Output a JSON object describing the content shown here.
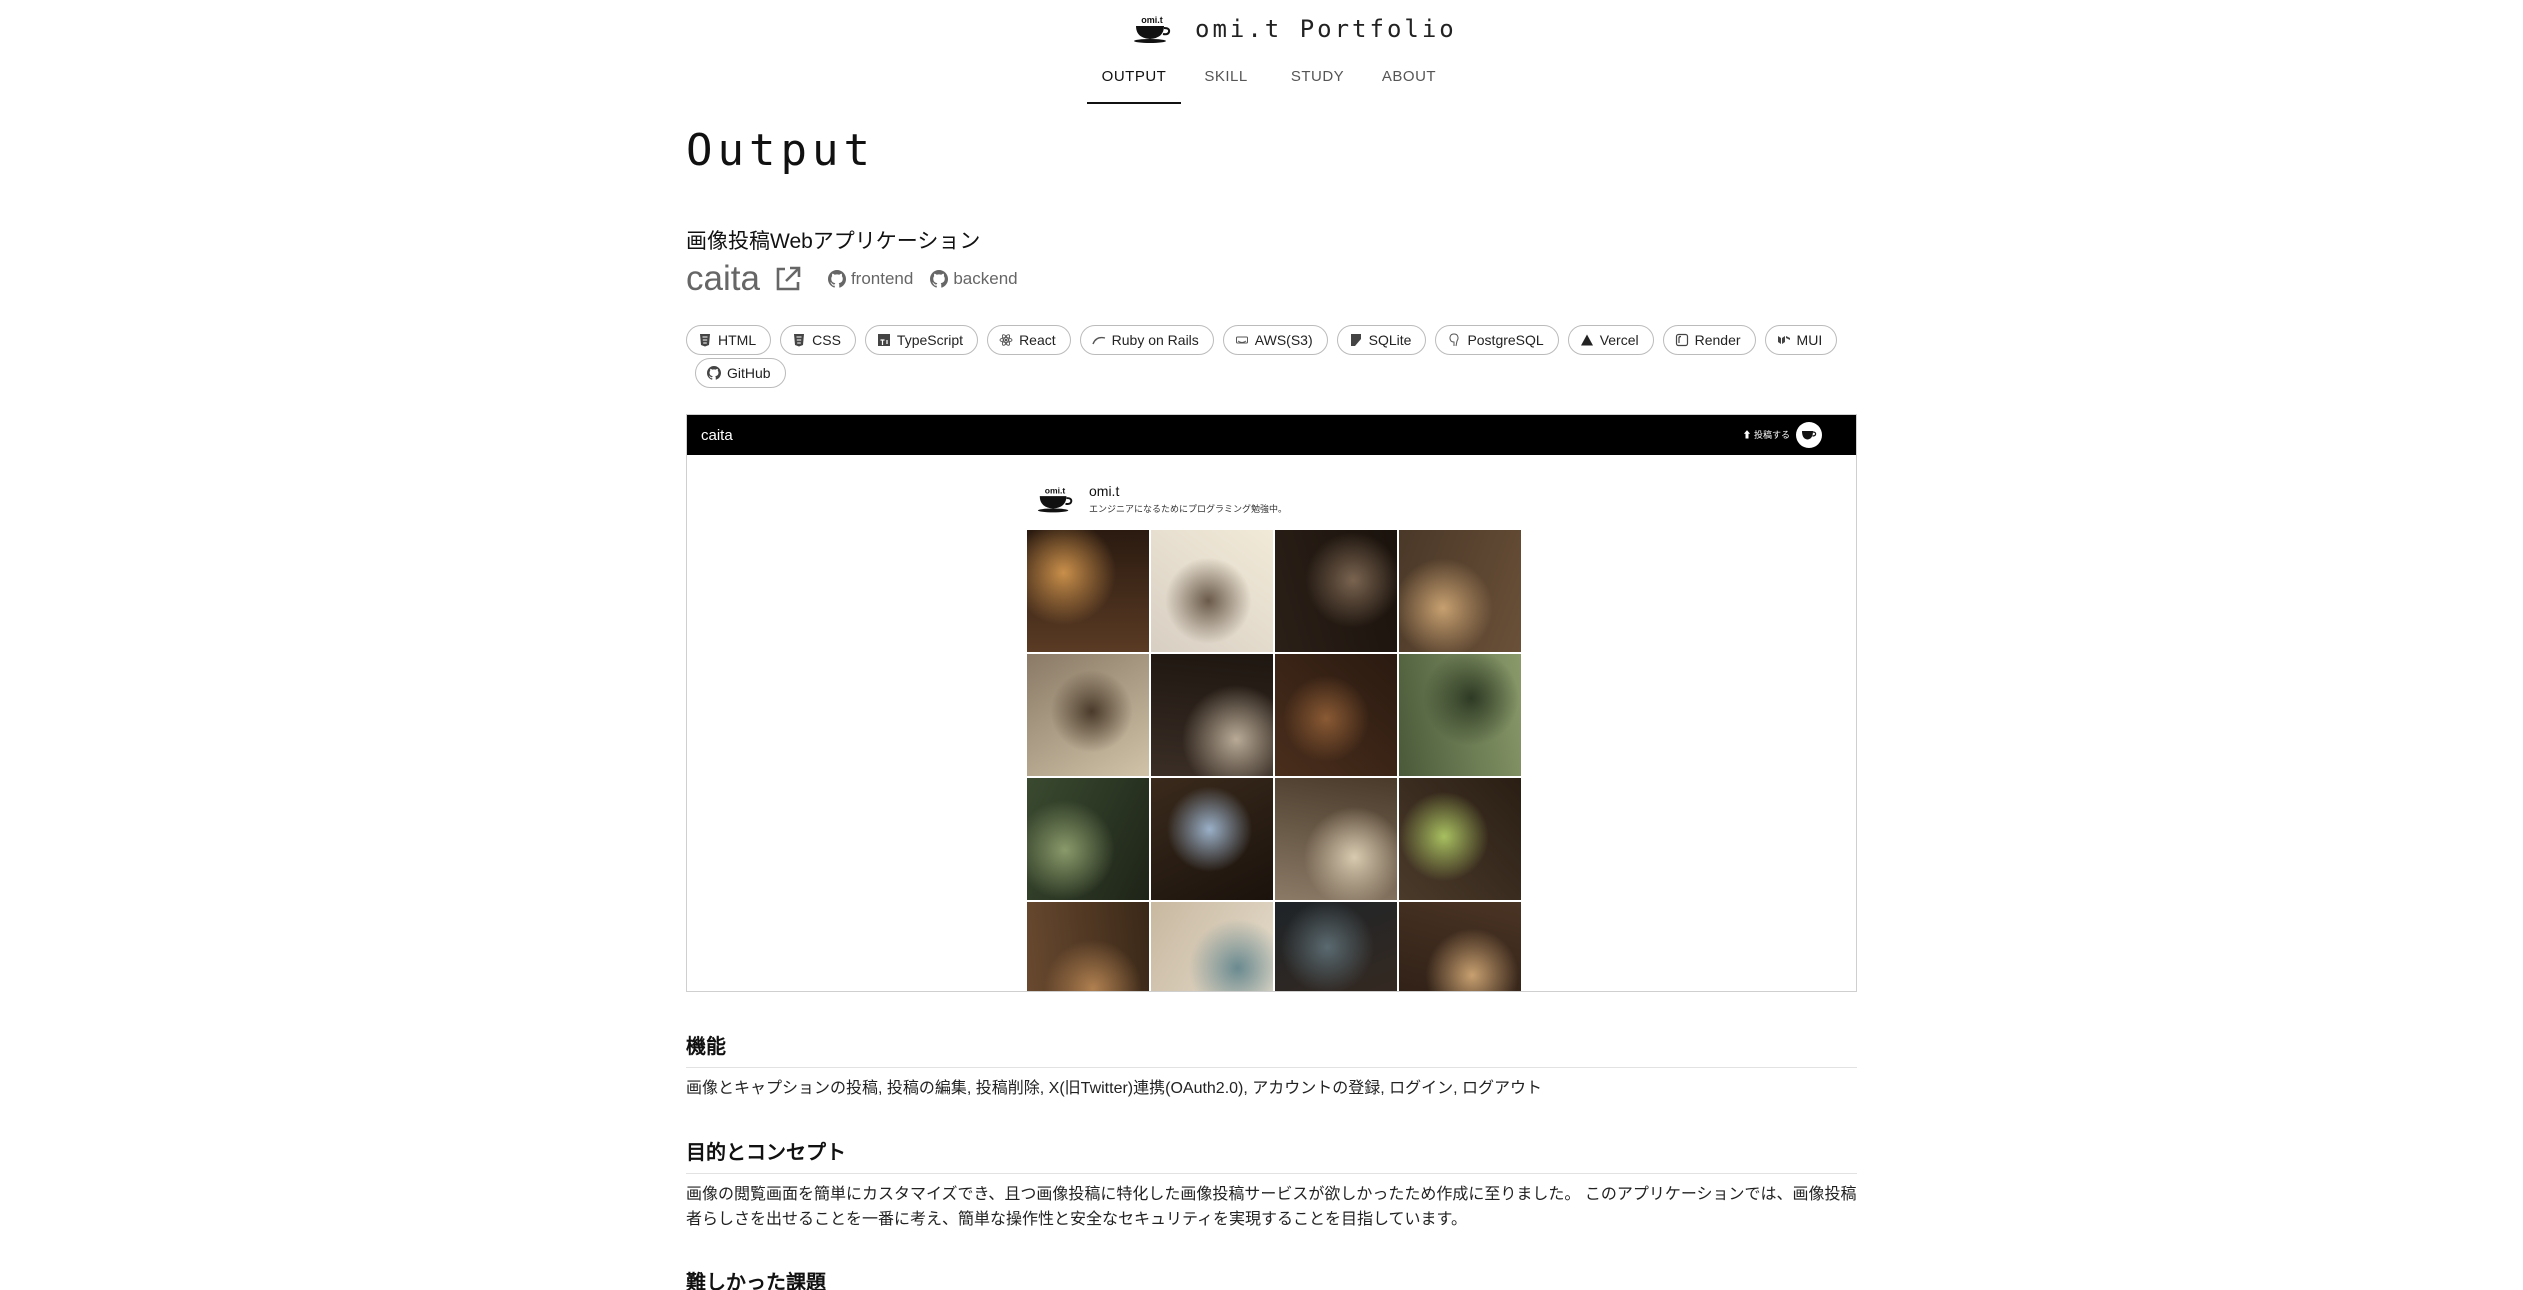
{
  "site": {
    "title": "omi.t Portfolio",
    "logo_text": "omi.t"
  },
  "nav": {
    "tabs": [
      {
        "label": "OUTPUT",
        "active": true
      },
      {
        "label": "SKILL",
        "active": false
      },
      {
        "label": "STUDY",
        "active": false
      },
      {
        "label": "ABOUT",
        "active": false
      }
    ]
  },
  "page": {
    "title": "Output"
  },
  "app": {
    "subtitle": "画像投稿Webアプリケーション",
    "name": "caita",
    "external_link_icon": "external-link-icon",
    "repos": [
      {
        "label": "frontend",
        "icon": "github-icon"
      },
      {
        "label": "backend",
        "icon": "github-icon"
      }
    ],
    "tags": [
      {
        "label": "HTML",
        "icon": "html5-icon"
      },
      {
        "label": "CSS",
        "icon": "css3-icon"
      },
      {
        "label": "TypeScript",
        "icon": "typescript-icon"
      },
      {
        "label": "React",
        "icon": "react-icon"
      },
      {
        "label": "Ruby on Rails",
        "icon": "rails-icon"
      },
      {
        "label": "AWS(S3)",
        "icon": "aws-icon"
      },
      {
        "label": "SQLite",
        "icon": "sqlite-icon"
      },
      {
        "label": "PostgreSQL",
        "icon": "postgresql-icon"
      },
      {
        "label": "Vercel",
        "icon": "vercel-icon"
      },
      {
        "label": "Render",
        "icon": "render-icon"
      },
      {
        "label": "MUI",
        "icon": "mui-icon"
      },
      {
        "label": "GitHub",
        "icon": "github-icon"
      }
    ]
  },
  "preview": {
    "app_title": "caita",
    "post_label": "投稿する",
    "profile_name": "omi.t",
    "profile_bio": "エンジニアになるためにプログラミング勉強中。",
    "photo_colors": [
      [
        "#5a3b24",
        "#c98f4a",
        "#2a1a10"
      ],
      [
        "#d8cfc3",
        "#6a5a4a",
        "#f2ead8"
      ],
      [
        "#2b2018",
        "#7a6450",
        "#1a120c"
      ],
      [
        "#4a3828",
        "#c7a070",
        "#6a5038"
      ],
      [
        "#8a7a66",
        "#4a3a2a",
        "#d0c3a8"
      ],
      [
        "#3a2e26",
        "#b8aa96",
        "#1e1610"
      ],
      [
        "#4a2e1c",
        "#8a5a34",
        "#2a1a10"
      ],
      [
        "#4a5a3a",
        "#2e3a24",
        "#8a9a6a"
      ],
      [
        "#3a4a30",
        "#8a9a6a",
        "#1e2418"
      ],
      [
        "#3a2a1c",
        "#9ab0c8",
        "#1a120c"
      ],
      [
        "#8a7a66",
        "#d8cab0",
        "#4a3a2a"
      ],
      [
        "#4a3a2a",
        "#a8c060",
        "#2a1e14"
      ],
      [
        "#6a4a30",
        "#b08050",
        "#3a2818"
      ],
      [
        "#c8b8a0",
        "#6a8a90",
        "#e8e0d0"
      ],
      [
        "#1e2428",
        "#5a6a70",
        "#3a2a20"
      ],
      [
        "#2a1c14",
        "#c8a070",
        "#4a3424"
      ]
    ]
  },
  "sections": [
    {
      "heading": "機能",
      "body": "画像とキャプションの投稿, 投稿の編集, 投稿削除, X(旧Twitter)連携(OAuth2.0), アカウントの登録, ログイン, ログアウト"
    },
    {
      "heading": "目的とコンセプト",
      "body": "画像の閲覧画面を簡単にカスタマイズでき、且つ画像投稿に特化した画像投稿サービスが欲しかったため作成に至りました。 このアプリケーションでは、画像投稿者らしさを出せることを一番に考え、簡単な操作性と安全なセキュリティを実現することを目指しています。"
    },
    {
      "heading": "難しかった課題",
      "body": ""
    }
  ]
}
